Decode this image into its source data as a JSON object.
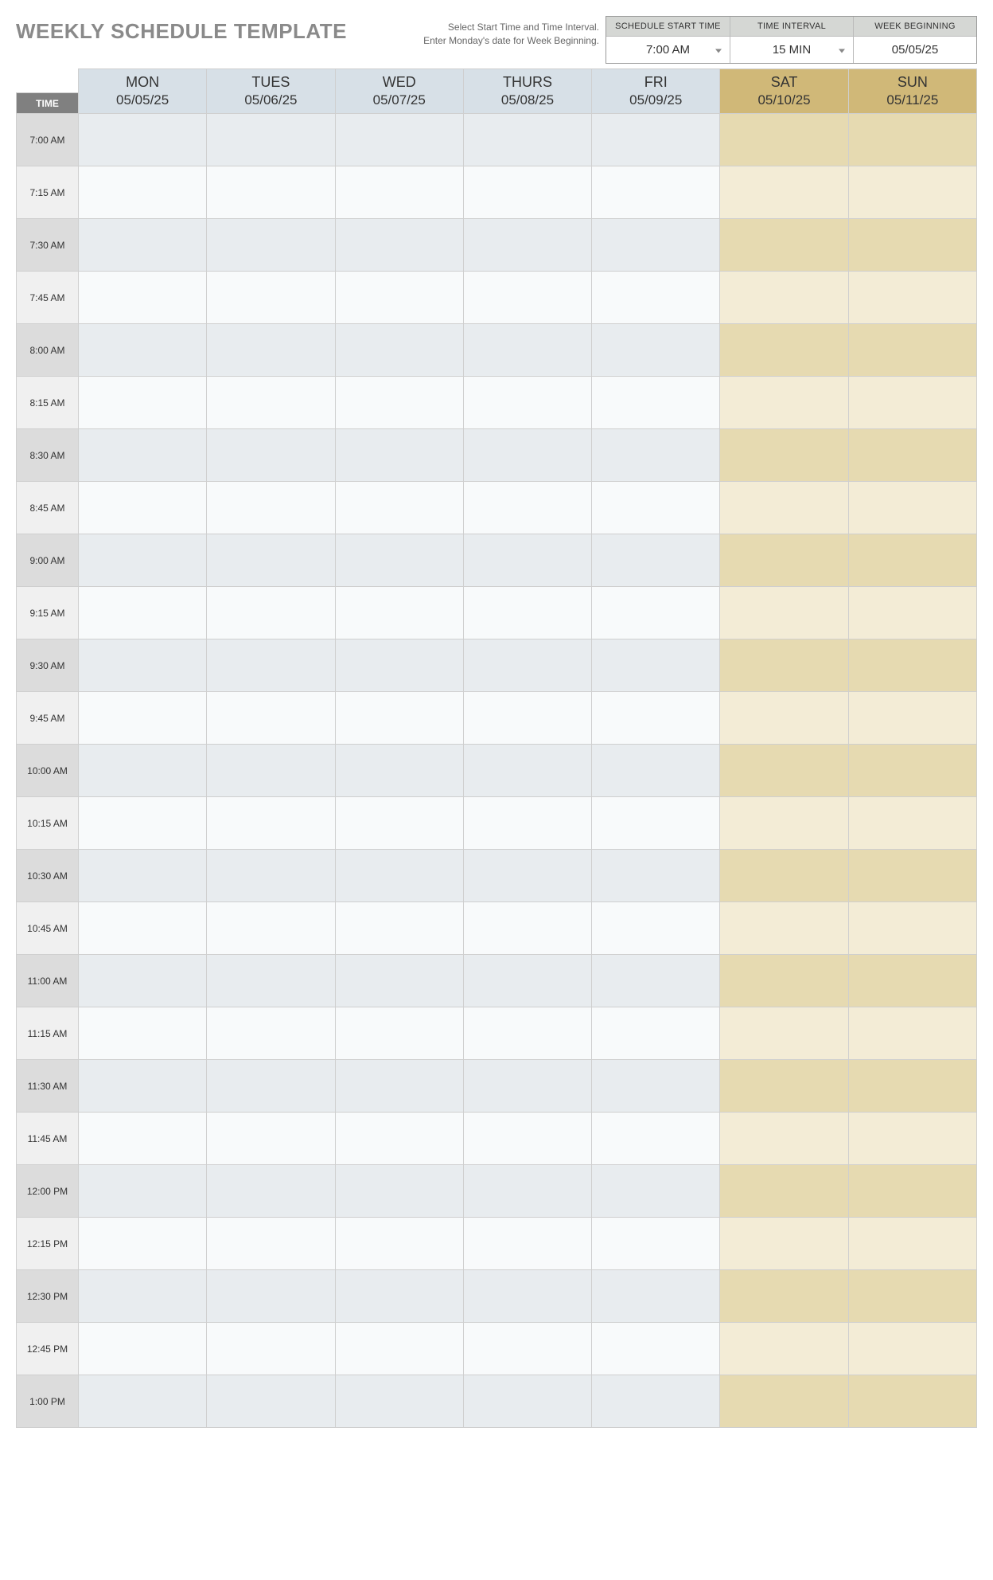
{
  "title": "WEEKLY SCHEDULE TEMPLATE",
  "instructions": {
    "line1": "Select Start Time and Time Interval.",
    "line2": "Enter Monday's date for Week Beginning."
  },
  "controls": {
    "start_time": {
      "label": "SCHEDULE START TIME",
      "value": "7:00 AM"
    },
    "interval": {
      "label": "TIME INTERVAL",
      "value": "15 MIN"
    },
    "week_begin": {
      "label": "WEEK BEGINNING",
      "value": "05/05/25"
    }
  },
  "time_header": "TIME",
  "days": [
    {
      "dow": "MON",
      "date": "05/05/25",
      "weekend": false
    },
    {
      "dow": "TUES",
      "date": "05/06/25",
      "weekend": false
    },
    {
      "dow": "WED",
      "date": "05/07/25",
      "weekend": false
    },
    {
      "dow": "THURS",
      "date": "05/08/25",
      "weekend": false
    },
    {
      "dow": "FRI",
      "date": "05/09/25",
      "weekend": false
    },
    {
      "dow": "SAT",
      "date": "05/10/25",
      "weekend": true
    },
    {
      "dow": "SUN",
      "date": "05/11/25",
      "weekend": true
    }
  ],
  "times": [
    "7:00 AM",
    "7:15 AM",
    "7:30 AM",
    "7:45 AM",
    "8:00 AM",
    "8:15 AM",
    "8:30 AM",
    "8:45 AM",
    "9:00 AM",
    "9:15 AM",
    "9:30 AM",
    "9:45 AM",
    "10:00 AM",
    "10:15 AM",
    "10:30 AM",
    "10:45 AM",
    "11:00 AM",
    "11:15 AM",
    "11:30 AM",
    "11:45 AM",
    "12:00 PM",
    "12:15 PM",
    "12:30 PM",
    "12:45 PM",
    "1:00 PM"
  ]
}
